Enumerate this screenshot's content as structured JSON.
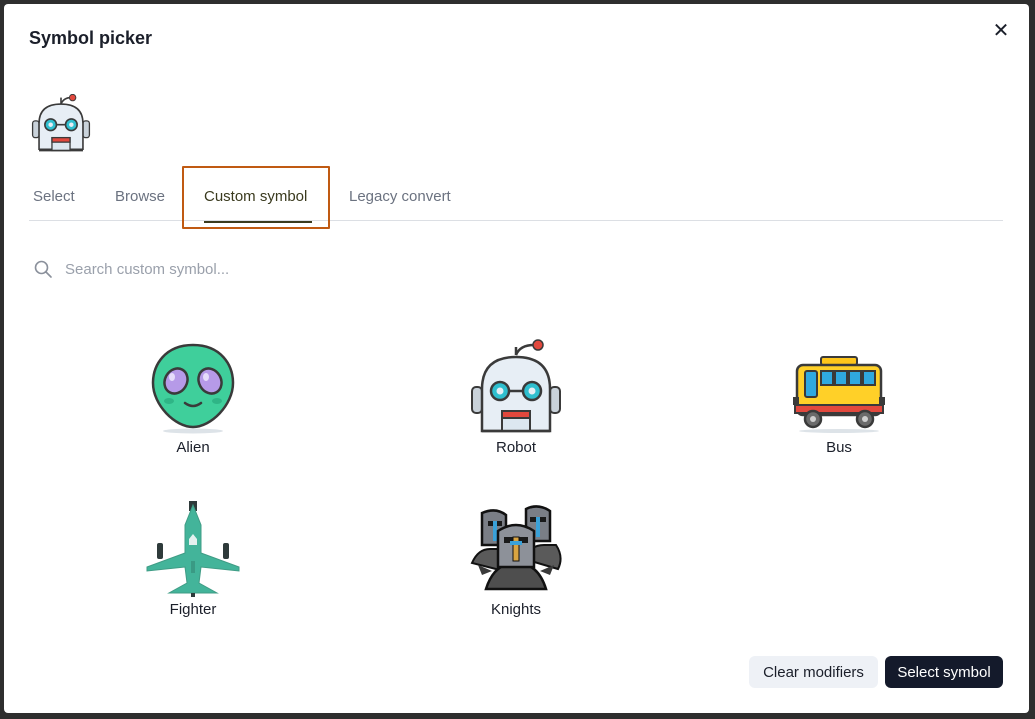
{
  "dialog": {
    "title": "Symbol picker",
    "close_icon": "close-icon",
    "close_glyph": "✕",
    "preview_icon": "robot-icon"
  },
  "tabs": [
    {
      "label": "Select",
      "active": false
    },
    {
      "label": "Browse",
      "active": false
    },
    {
      "label": "Custom symbol",
      "active": true
    },
    {
      "label": "Legacy convert",
      "active": false
    }
  ],
  "search": {
    "placeholder": "Search custom symbol...",
    "value": "",
    "icon": "search-icon"
  },
  "symbols": [
    {
      "label": "Alien",
      "icon": "alien-icon"
    },
    {
      "label": "Robot",
      "icon": "robot-icon"
    },
    {
      "label": "Bus",
      "icon": "bus-icon"
    },
    {
      "label": "Fighter",
      "icon": "fighter-jet-icon"
    },
    {
      "label": "Knights",
      "icon": "knights-icon"
    }
  ],
  "footer": {
    "clear_label": "Clear modifiers",
    "select_label": "Select symbol"
  },
  "colors": {
    "primary_button": "#141a2b",
    "secondary_button": "#eef1f6",
    "active_tab": "#3a3a1e",
    "highlight_border": "#c05a12"
  }
}
